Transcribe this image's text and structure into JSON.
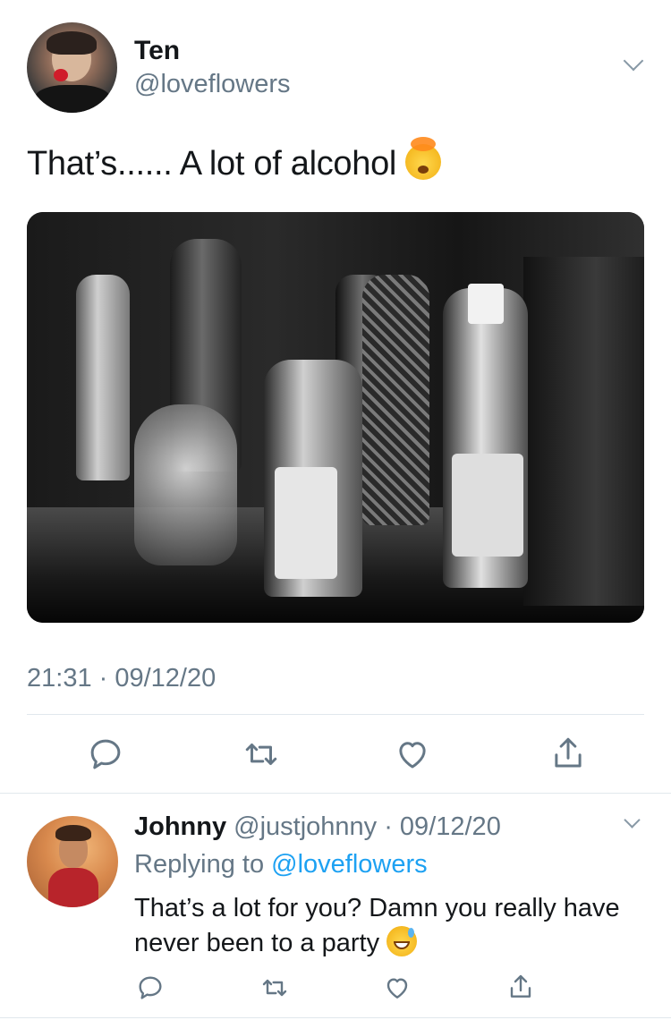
{
  "tweet": {
    "author_name": "Ten",
    "author_handle": "@loveflowers",
    "text": "That’s...... A lot of alcohol",
    "text_emoji": "exploding-head-emoji",
    "timestamp": "21:31 · 09/12/20",
    "actions": [
      "reply-icon",
      "retweet-icon",
      "like-icon",
      "share-icon"
    ]
  },
  "reply": {
    "author_name": "Johnny",
    "author_handle": "@justjohnny",
    "date": "· 09/12/20",
    "replying_prefix": "Replying to",
    "replying_to": "@loveflowers",
    "text": "That’s a lot for you? Damn you really have never been to a party",
    "text_emoji": "grinning-face-with-sweat-emoji",
    "actions": [
      "reply-icon",
      "retweet-icon",
      "like-icon",
      "share-icon"
    ]
  },
  "colors": {
    "text_primary": "#14171a",
    "text_secondary": "#657786",
    "link": "#1da1f2",
    "icon": "#657786",
    "divider": "#e1e8ed"
  }
}
